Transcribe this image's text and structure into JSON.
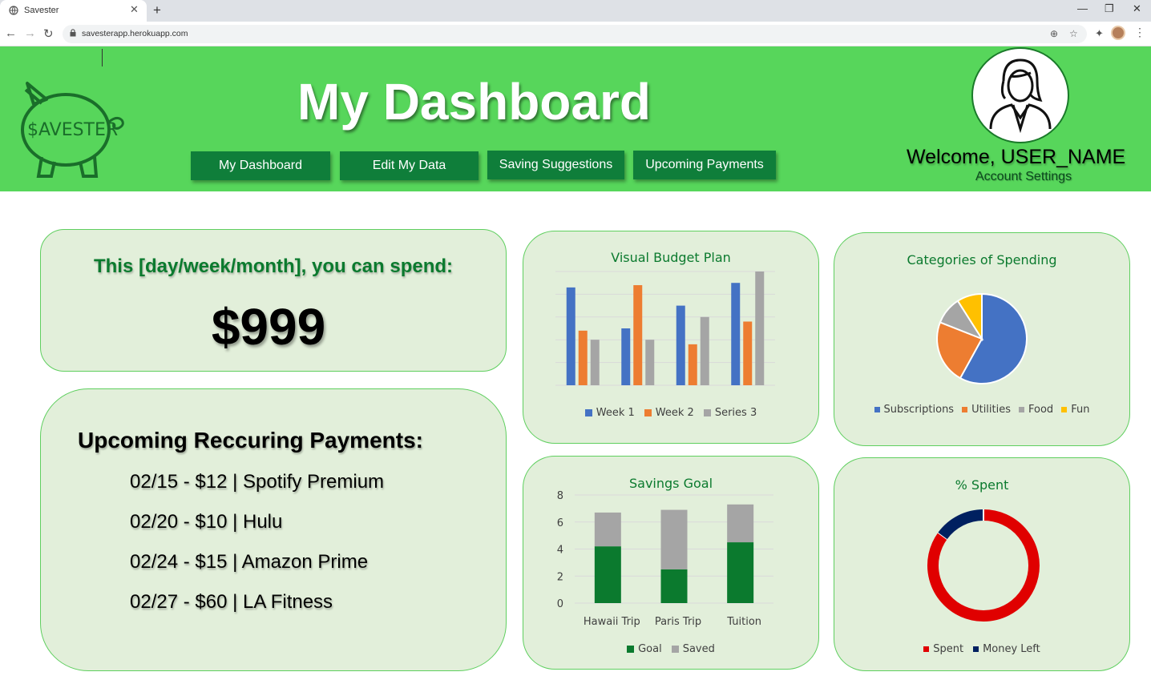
{
  "browser": {
    "tab_title": "Savester",
    "url": "savesterapp.herokuapp.com",
    "new_tab": "+",
    "close_tab": "✕",
    "minimize": "—",
    "restore": "❐",
    "close_window": "✕"
  },
  "header": {
    "logo_text": "$AVESTER",
    "title": "My Dashboard",
    "nav": [
      {
        "label": "My Dashboard"
      },
      {
        "label": "Edit My Data"
      },
      {
        "label": "Saving Suggestions"
      },
      {
        "label": "Upcoming Payments"
      }
    ],
    "welcome": "Welcome, USER_NAME",
    "account_settings": "Account Settings",
    "brand_color": "#57d65b",
    "button_color": "#0f7e3a"
  },
  "spend": {
    "title": "This [day/week/month], you can spend:",
    "amount": "$999"
  },
  "payments": {
    "title": "Upcoming Reccuring Payments:",
    "items": [
      "02/15 - $12 | Spotify Premium",
      "02/20 - $10 | Hulu",
      "02/24 - $15 | Amazon Prime",
      "02/27 - $60 | LA Fitness"
    ]
  },
  "chart_data": [
    {
      "type": "bar",
      "title": "Visual Budget Plan",
      "categories": [
        "",
        "",
        "",
        ""
      ],
      "series": [
        {
          "name": "Week 1",
          "color": "#4472c4",
          "values": [
            4.3,
            2.5,
            3.5,
            4.5
          ]
        },
        {
          "name": "Week 2",
          "color": "#ed7d31",
          "values": [
            2.4,
            4.4,
            1.8,
            2.8
          ]
        },
        {
          "name": "Series 3",
          "color": "#a5a5a5",
          "values": [
            2.0,
            2.0,
            3.0,
            5.0
          ]
        }
      ],
      "ylim": [
        0,
        5
      ],
      "grid": true,
      "legend": "bottom"
    },
    {
      "type": "pie",
      "title": "Categories of Spending",
      "categories": [
        "Subscriptions",
        "Utilities",
        "Food",
        "Fun"
      ],
      "values": [
        58,
        23,
        10,
        9
      ],
      "colors": [
        "#4472c4",
        "#ed7d31",
        "#a5a5a5",
        "#ffc000"
      ],
      "legend": "bottom"
    },
    {
      "type": "bar",
      "stacked": true,
      "title": "Savings Goal",
      "categories": [
        "Hawaii Trip",
        "Paris Trip",
        "Tuition"
      ],
      "series": [
        {
          "name": "Goal",
          "color": "#0b7a2e",
          "values": [
            4.2,
            2.5,
            4.5
          ]
        },
        {
          "name": "Saved",
          "color": "#a5a5a5",
          "values": [
            2.5,
            4.4,
            2.8
          ]
        }
      ],
      "yticks": [
        "0",
        "2",
        "4",
        "6",
        "8"
      ],
      "ylim": [
        0,
        8
      ],
      "grid": true,
      "legend": "bottom"
    },
    {
      "type": "pie",
      "donut": true,
      "title": "% Spent",
      "categories": [
        "Spent",
        "Money Left"
      ],
      "values": [
        85,
        15
      ],
      "colors": [
        "#e00000",
        "#002060"
      ],
      "legend": "bottom"
    }
  ]
}
